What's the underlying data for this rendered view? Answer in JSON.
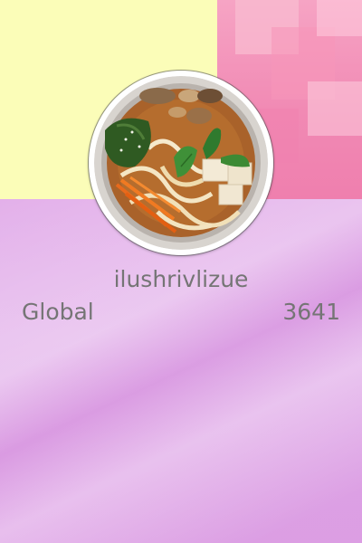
{
  "profile": {
    "username": "ilushrivlizue",
    "scope_label": "Global",
    "score": "3641"
  },
  "colors": {
    "banner_yellow": "#fbfdb8",
    "banner_pink": "#f18ab4",
    "lower_lilac": "#e3b0ea",
    "text_gray": "#757575"
  },
  "avatar": {
    "icon": "noodle-soup-bowl-photo"
  }
}
